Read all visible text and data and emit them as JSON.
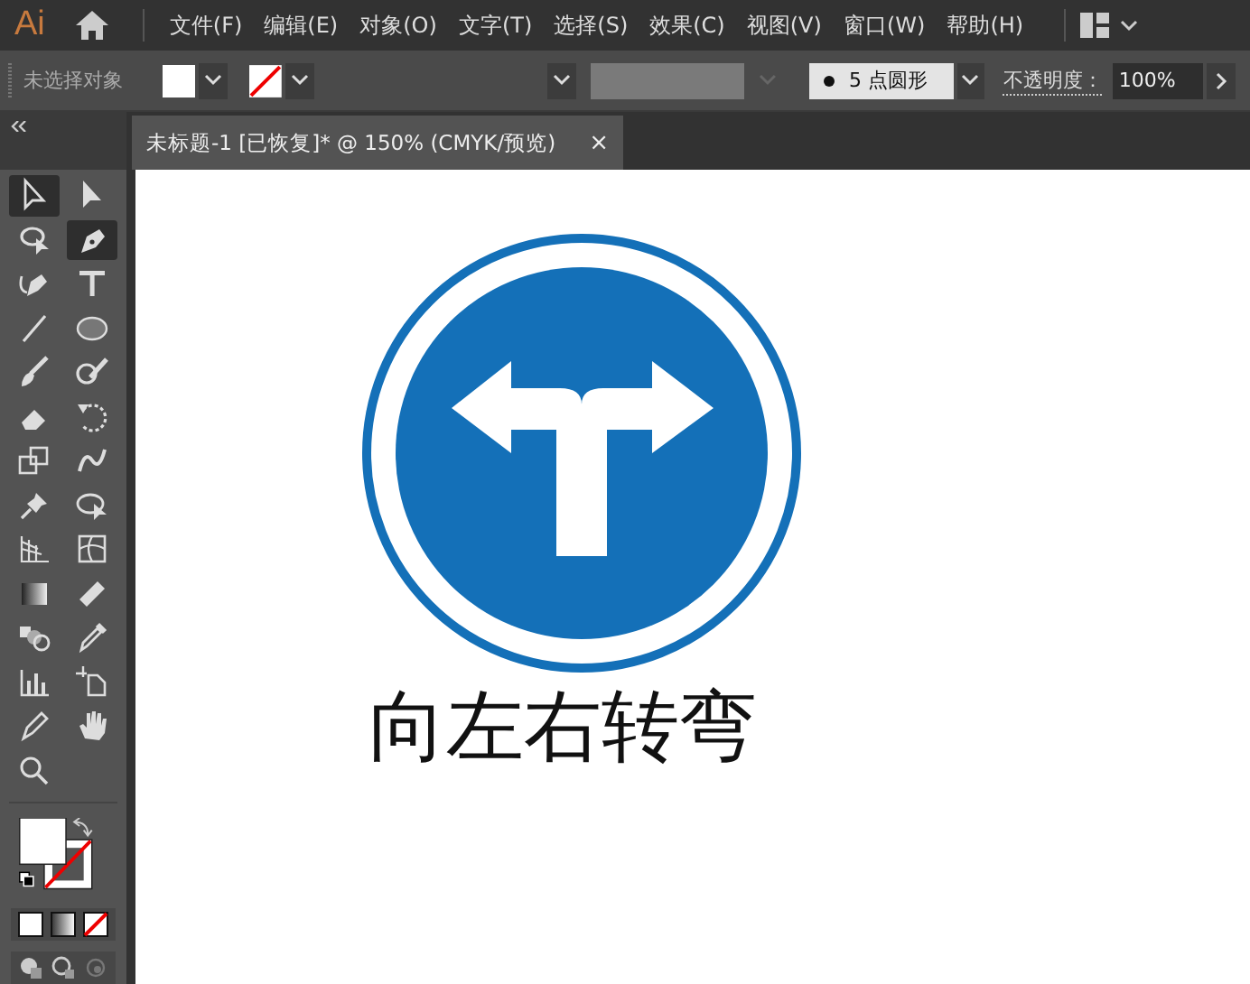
{
  "app_logo": "Ai",
  "menus": [
    "文件(F)",
    "编辑(E)",
    "对象(O)",
    "文字(T)",
    "选择(S)",
    "效果(C)",
    "视图(V)",
    "窗口(W)",
    "帮助(H)"
  ],
  "control_bar": {
    "selection_status": "未选择对象",
    "brush": "5 点圆形",
    "opacity_label": "不透明度：",
    "opacity_value": "100%"
  },
  "document_tab": {
    "title": "未标题-1 [已恢复]* @ 150% (CMYK/预览)",
    "close": "×",
    "selected": true
  },
  "tools": [
    {
      "kind": "pointer",
      "selected": true
    },
    {
      "kind": "direct-pointer",
      "selected": false
    },
    {
      "kind": "lasso",
      "selected": false
    },
    {
      "kind": "pen",
      "selected": true
    },
    {
      "kind": "curvature",
      "selected": false
    },
    {
      "kind": "type",
      "selected": false
    },
    {
      "kind": "line",
      "selected": false
    },
    {
      "kind": "ellipse",
      "selected": false
    },
    {
      "kind": "brush",
      "selected": false
    },
    {
      "kind": "blob-brush",
      "selected": false
    },
    {
      "kind": "eraser",
      "selected": false
    },
    {
      "kind": "rotate",
      "selected": false
    },
    {
      "kind": "scale",
      "selected": false
    },
    {
      "kind": "warp",
      "selected": false
    },
    {
      "kind": "pin",
      "selected": false
    },
    {
      "kind": "shape-builder",
      "selected": false
    },
    {
      "kind": "perspective-grid",
      "selected": false
    },
    {
      "kind": "mesh",
      "selected": false
    },
    {
      "kind": "gradient",
      "selected": false
    },
    {
      "kind": "ruler",
      "selected": false
    },
    {
      "kind": "blend",
      "selected": false
    },
    {
      "kind": "eyedropper",
      "selected": false
    },
    {
      "kind": "graph",
      "selected": false
    },
    {
      "kind": "artboard",
      "selected": false
    },
    {
      "kind": "pencil",
      "selected": false
    },
    {
      "kind": "hand",
      "selected": false
    },
    {
      "kind": "zoom",
      "selected": false
    }
  ],
  "canvas": {
    "caption": "向左右转弯"
  }
}
